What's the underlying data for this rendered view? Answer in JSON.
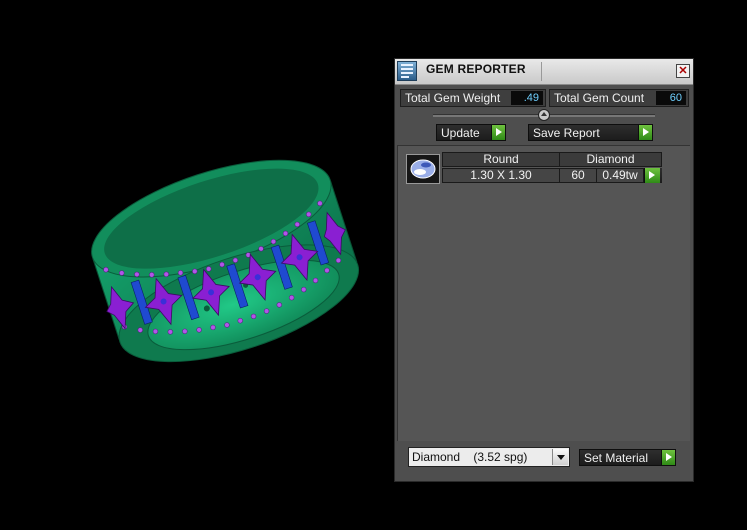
{
  "panel": {
    "title": "GEM REPORTER",
    "close_glyph": "✕",
    "icons": {
      "app": "gem-reporter-app-icon",
      "close": "close-icon"
    }
  },
  "stats": {
    "total_weight_label": "Total Gem Weight",
    "total_weight_value": ".49",
    "total_count_label": "Total Gem Count",
    "total_count_value": "60"
  },
  "slider": {
    "position_fraction": 0.5
  },
  "buttons": {
    "update_label": "Update",
    "save_report_label": "Save Report",
    "set_material_label": "Set Material"
  },
  "gem_table": {
    "headers": [
      "Round",
      "Diamond"
    ],
    "rows": [
      {
        "size": "1.30 X 1.30",
        "count": "60",
        "weight": "0.49tw"
      }
    ]
  },
  "material_select": {
    "selected": "Diamond    (3.52 spg)"
  },
  "colors": {
    "ring_green": "#17a86e",
    "ring_purple": "#8a1fd2",
    "gem_blue": "#1f4ad0",
    "accent_value": "#6fd0ff",
    "go_button": "#3f9f22"
  }
}
